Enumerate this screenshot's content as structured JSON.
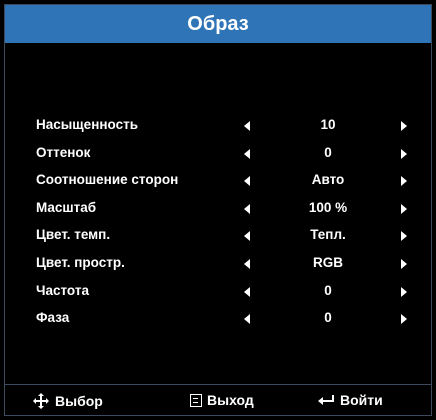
{
  "title": "Образ",
  "rows": [
    {
      "label": "Насыщенность",
      "value": "10"
    },
    {
      "label": "Оттенок",
      "value": "0"
    },
    {
      "label": "Соотношение сторон",
      "value": "Авто"
    },
    {
      "label": "Масштаб",
      "value": "100 %"
    },
    {
      "label": "Цвет. темп.",
      "value": "Тепл."
    },
    {
      "label": "Цвет. простр.",
      "value": "RGB"
    },
    {
      "label": "Частота",
      "value": "0"
    },
    {
      "label": "Фаза",
      "value": "0"
    }
  ],
  "footer": {
    "select_label": "Выбор",
    "exit_label": "Выход",
    "enter_label": "Войти"
  },
  "colors": {
    "title_bar": "#2e74b6",
    "background": "#000000",
    "text": "#ffffff"
  }
}
